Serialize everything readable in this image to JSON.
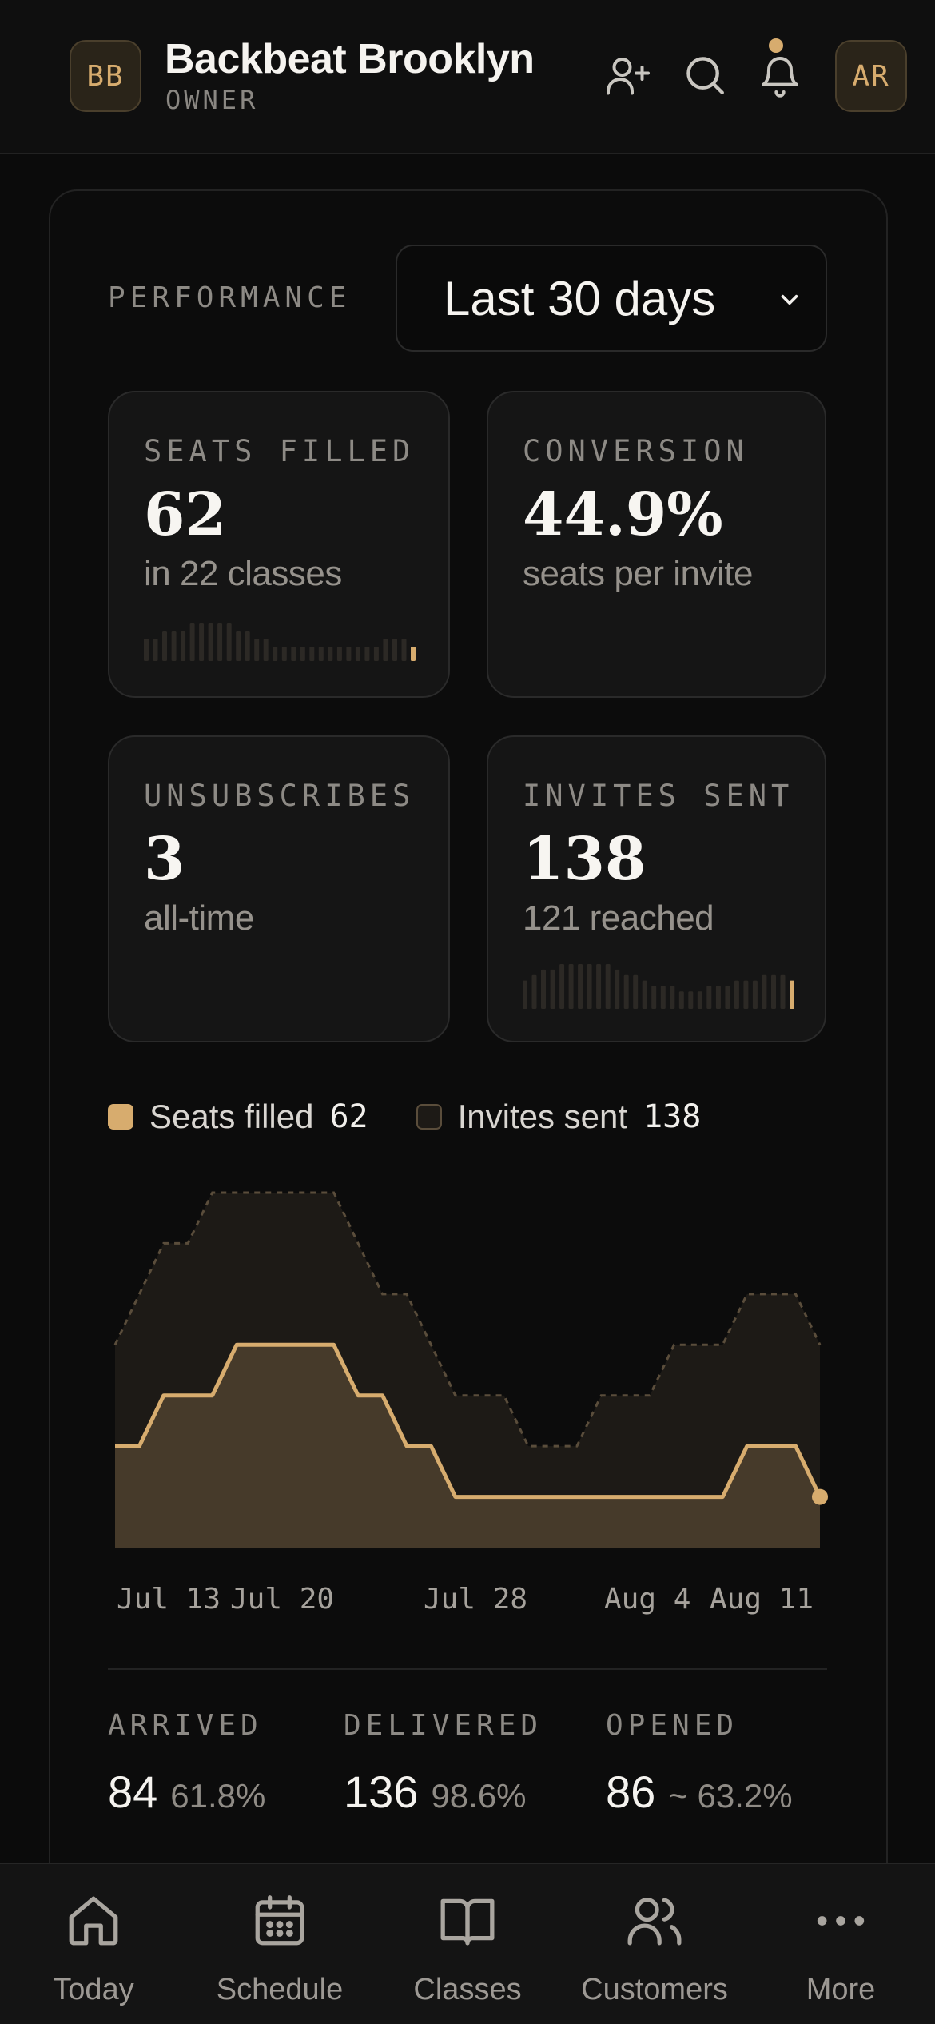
{
  "header": {
    "org_initials": "BB",
    "org_name": "Backbeat Brooklyn",
    "org_role": "OWNER",
    "user_initials": "AR",
    "icons": [
      "add-user-icon",
      "search-icon",
      "bell-icon"
    ]
  },
  "performance": {
    "label": "PERFORMANCE",
    "range_value": "Last 30 days"
  },
  "stats": [
    {
      "label": "SEATS FILLED",
      "value": "62",
      "sub": "in 22 classes"
    },
    {
      "label": "CONVERSION",
      "value": "44.9%",
      "sub": "seats per invite"
    },
    {
      "label": "UNSUBSCRIBES",
      "value": "3",
      "sub": "all-time"
    },
    {
      "label": "INVITES SENT",
      "value": "138",
      "sub": "121 reached"
    }
  ],
  "legend": [
    {
      "name": "Seats filled",
      "count": "62"
    },
    {
      "name": "Invites sent",
      "count": "138"
    }
  ],
  "colors": {
    "accent": "#d7ac6e",
    "seats_fill": "#463a2a",
    "invites_fill": "#1d1a16",
    "invites_stroke": "#5a4d3b"
  },
  "chart_data": {
    "type": "area",
    "x_ticks": [
      "Jul 13",
      "Jul 20",
      "Jul 28",
      "Aug 4",
      "Aug 11"
    ],
    "series": [
      {
        "name": "Seats filled",
        "values": [
          2,
          2,
          3,
          3,
          3,
          4,
          4,
          4,
          4,
          4,
          3,
          3,
          2,
          2,
          1,
          1,
          1,
          1,
          1,
          1,
          1,
          1,
          1,
          1,
          1,
          1,
          2,
          2,
          2,
          1
        ]
      },
      {
        "name": "Invites sent",
        "values": [
          4,
          5,
          6,
          6,
          7,
          7,
          7,
          7,
          7,
          7,
          6,
          5,
          5,
          4,
          3,
          3,
          3,
          2,
          2,
          2,
          3,
          3,
          3,
          4,
          4,
          4,
          5,
          5,
          5,
          4
        ]
      }
    ],
    "ylim": [
      0,
      7
    ],
    "grid": false
  },
  "metrics": [
    {
      "label": "ARRIVED",
      "value": "84",
      "pct": "61.8%"
    },
    {
      "label": "DELIVERED",
      "value": "136",
      "pct": "98.6%"
    },
    {
      "label": "OPENED",
      "value": "86",
      "pct": "~ 63.2%"
    }
  ],
  "nav": [
    {
      "label": "Today",
      "icon": "home-icon"
    },
    {
      "label": "Schedule",
      "icon": "calendar-icon"
    },
    {
      "label": "Classes",
      "icon": "book-icon"
    },
    {
      "label": "Customers",
      "icon": "users-icon"
    },
    {
      "label": "More",
      "icon": "more-icon"
    }
  ]
}
